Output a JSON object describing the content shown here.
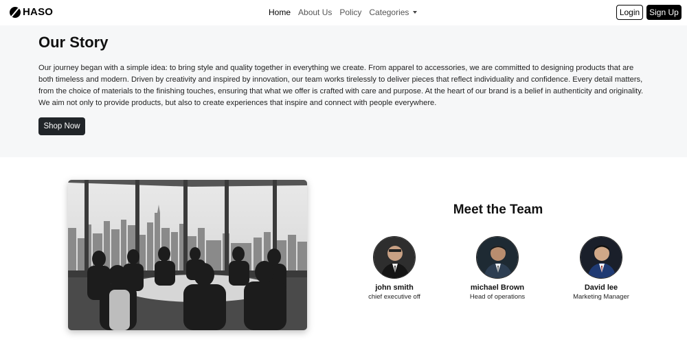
{
  "brand": {
    "name": "HASO"
  },
  "nav": {
    "items": [
      {
        "label": "Home",
        "active": true
      },
      {
        "label": "About Us"
      },
      {
        "label": "Policy"
      },
      {
        "label": "Categories",
        "dropdown": true
      }
    ],
    "login_label": "Login",
    "signup_label": "Sign Up"
  },
  "story": {
    "title": "Our Story",
    "text": "Our journey began with a simple idea: to bring style and quality together in everything we create. From apparel to accessories, we are committed to designing products that are both timeless and modern. Driven by creativity and inspired by innovation, our team works tirelessly to deliver pieces that reflect individuality and confidence. Every detail matters, from the choice of materials to the finishing touches, ensuring that what we offer is crafted with care and purpose. At the heart of our brand is a belief in authenticity and originality. We aim not only to provide products, but also to create experiences that inspire and connect with people everywhere.",
    "button_label": "Shop Now"
  },
  "team": {
    "title": "Meet the Team",
    "members": [
      {
        "name": "john smith",
        "role": "chief executive off"
      },
      {
        "name": "michael Brown",
        "role": "Head of operations"
      },
      {
        "name": "David lee",
        "role": "Marketing Manager"
      }
    ]
  }
}
